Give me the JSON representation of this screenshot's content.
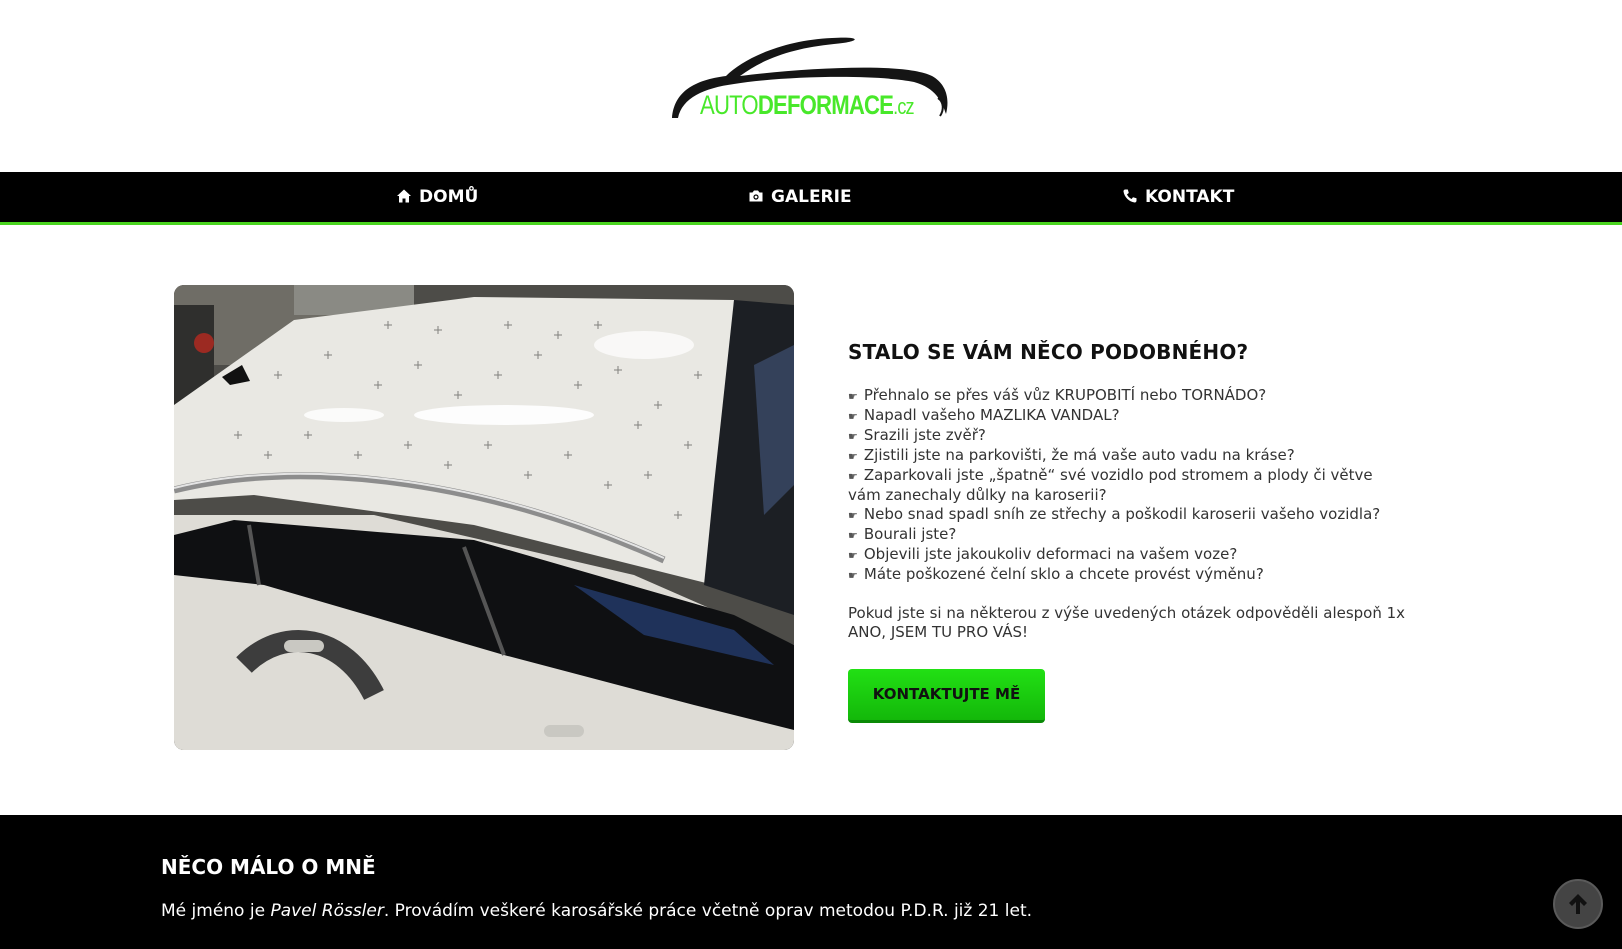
{
  "logo": {
    "part1": "AUTO",
    "part2": "DEFORMACE",
    "part3": ".cz",
    "icon": "car-silhouette-logo"
  },
  "nav": {
    "items": [
      {
        "label": "DOMŮ",
        "icon": "home-icon"
      },
      {
        "label": "GALERIE",
        "icon": "camera-icon"
      },
      {
        "label": "KONTAKT",
        "icon": "phone-icon"
      }
    ]
  },
  "hero": {
    "image_alt": "white car with hail damage marked on roof",
    "heading": "STALO SE VÁM NĚCO PODOBNÉHO?",
    "bullet_icon": "hand-pointing-icon",
    "questions": [
      "Přehnalo se přes váš vůz KRUPOBITÍ nebo TORNÁDO?",
      "Napadl vašeho MAZLIKA VANDAL?",
      "Srazili jste zvěř?",
      "Zjistili jste na parkovišti, že má vaše auto vadu na kráse?",
      "Zaparkovali jste „špatně“ své vozidlo pod stromem a plody či větve vám zanechaly důlky na karoserii?",
      "Nebo snad spadl sníh ze střechy a poškodil karoserii vašeho vozidla?",
      "Bourali jste?",
      "Objevili jste jakoukoliv deformaci na vašem voze?",
      "Máte poškozené čelní sklo a chcete provést výměnu?"
    ],
    "note": "Pokud jste si na některou z výše uvedených otázek odpověděli alespoň 1x ANO, JSEM TU PRO VÁS!",
    "cta_label": "KONTAKTUJTE MĚ"
  },
  "about": {
    "heading": "NĚCO MÁLO O MNĚ",
    "intro_prefix": "Mé jméno je ",
    "name": "Pavel Rössler",
    "intro_suffix": ". Provádím veškeré karosářské práce včetně oprav metodou P.D.R. již 21 let."
  },
  "colors": {
    "accent": "#4ad41f",
    "button": "#1ccc10",
    "nav_bg": "#000000"
  }
}
